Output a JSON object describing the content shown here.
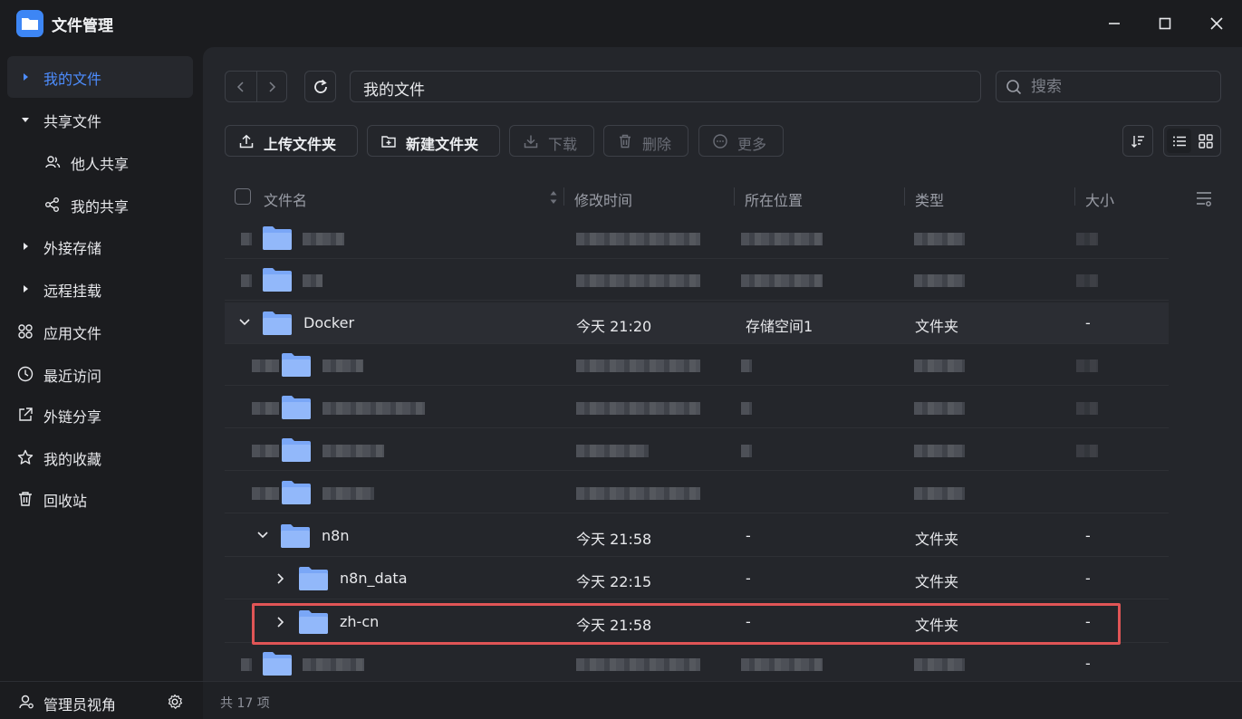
{
  "window": {
    "title": "文件管理"
  },
  "sidebar": {
    "items": [
      {
        "label": "我的文件"
      },
      {
        "label": "共享文件"
      },
      {
        "label": "他人共享"
      },
      {
        "label": "我的共享"
      },
      {
        "label": "外接存储"
      },
      {
        "label": "远程挂载"
      },
      {
        "label": "应用文件"
      },
      {
        "label": "最近访问"
      },
      {
        "label": "外链分享"
      },
      {
        "label": "我的收藏"
      },
      {
        "label": "回收站"
      }
    ],
    "footer_label": "管理员视角"
  },
  "toolbar": {
    "path": "我的文件",
    "search_placeholder": "搜索",
    "upload_label": "上传文件夹",
    "new_folder_label": "新建文件夹",
    "download_label": "下载",
    "delete_label": "删除",
    "more_label": "更多"
  },
  "table": {
    "headers": {
      "name": "文件名",
      "modified": "修改时间",
      "location": "所在位置",
      "type": "类型",
      "size": "大小"
    },
    "rows": [
      {
        "name": "Docker",
        "modified": "今天 21:20",
        "location": "存储空间1",
        "type": "文件夹",
        "size": "-"
      },
      {
        "name": "n8n",
        "modified": "今天 21:58",
        "location": "-",
        "type": "文件夹",
        "size": "-"
      },
      {
        "name": "n8n_data",
        "modified": "今天 22:15",
        "location": "-",
        "type": "文件夹",
        "size": "-"
      },
      {
        "name": "zh-cn",
        "modified": "今天 21:58",
        "location": "-",
        "type": "文件夹",
        "size": "-"
      },
      {
        "size": "-"
      }
    ]
  },
  "status": {
    "count_text": "共 17 项"
  },
  "colors": {
    "accent": "#4d8dff",
    "folder": "#7aa7f7",
    "highlight_border": "#e05556"
  }
}
